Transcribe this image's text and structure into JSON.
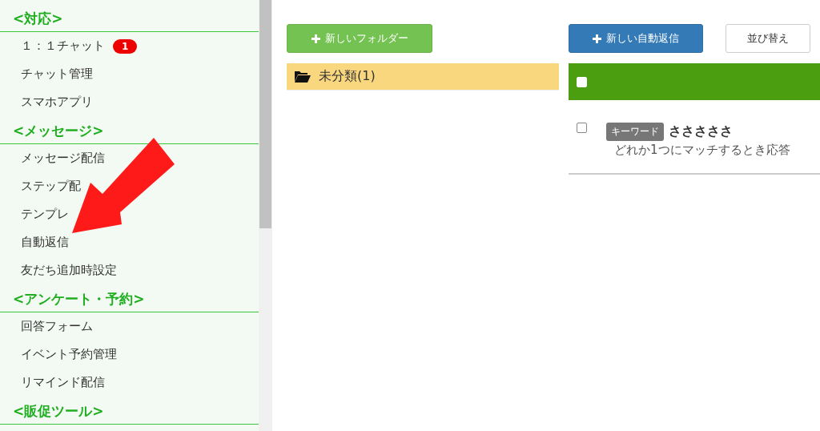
{
  "sidebar": {
    "sections": [
      {
        "title": "<対応>",
        "items": [
          {
            "label": "１：１チャット",
            "badge": "1"
          },
          {
            "label": "チャット管理"
          },
          {
            "label": "スマホアプリ"
          }
        ]
      },
      {
        "title": "<メッセージ>",
        "items": [
          {
            "label": "メッセージ配信"
          },
          {
            "label": "ステップ配"
          },
          {
            "label": "テンプレ"
          },
          {
            "label": "自動返信"
          },
          {
            "label": "友だち追加時設定"
          }
        ]
      },
      {
        "title": "<アンケート・予約>",
        "items": [
          {
            "label": "回答フォーム"
          },
          {
            "label": "イベント予約管理"
          },
          {
            "label": "リマインド配信"
          }
        ]
      },
      {
        "title": "<販促ツール>"
      }
    ]
  },
  "folders": {
    "new_button": "新しいフォルダー",
    "items": [
      {
        "label": "未分類(1)",
        "selected": true
      }
    ]
  },
  "replies": {
    "new_button": "新しい自動返信",
    "sort_button": "並び替え",
    "header_checked": false,
    "rows": [
      {
        "checked": false,
        "tag": "キーワード",
        "title": "さささささ",
        "description": "どれか1つにマッチするとき応答"
      }
    ]
  }
}
